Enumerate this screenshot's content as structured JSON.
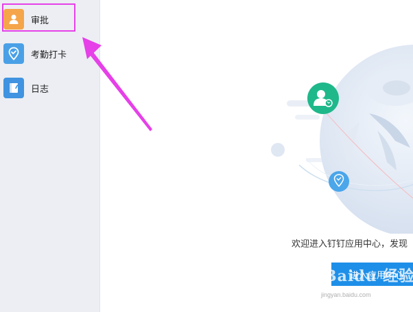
{
  "sidebar": {
    "items": [
      {
        "label": "审批",
        "icon": "person-icon",
        "color": "#f5a54a",
        "selected": true
      },
      {
        "label": "考勤打卡",
        "icon": "location-check-icon",
        "color": "#4aa0e6"
      },
      {
        "label": "日志",
        "icon": "notebook-icon",
        "color": "#3f93e0"
      }
    ]
  },
  "main": {
    "welcome_text": "欢迎进入钉钉应用中心，发现",
    "enter_button_label": "进入应用中心"
  },
  "annotation": {
    "color": "#e640e8"
  },
  "watermark": {
    "logo_text": "Baidu 经验",
    "url_text": "jingyan.baidu.com"
  },
  "colors": {
    "sidebar_bg": "#eceef3",
    "accent_blue": "#1e8fe8",
    "contact_green": "#1fb88a"
  }
}
